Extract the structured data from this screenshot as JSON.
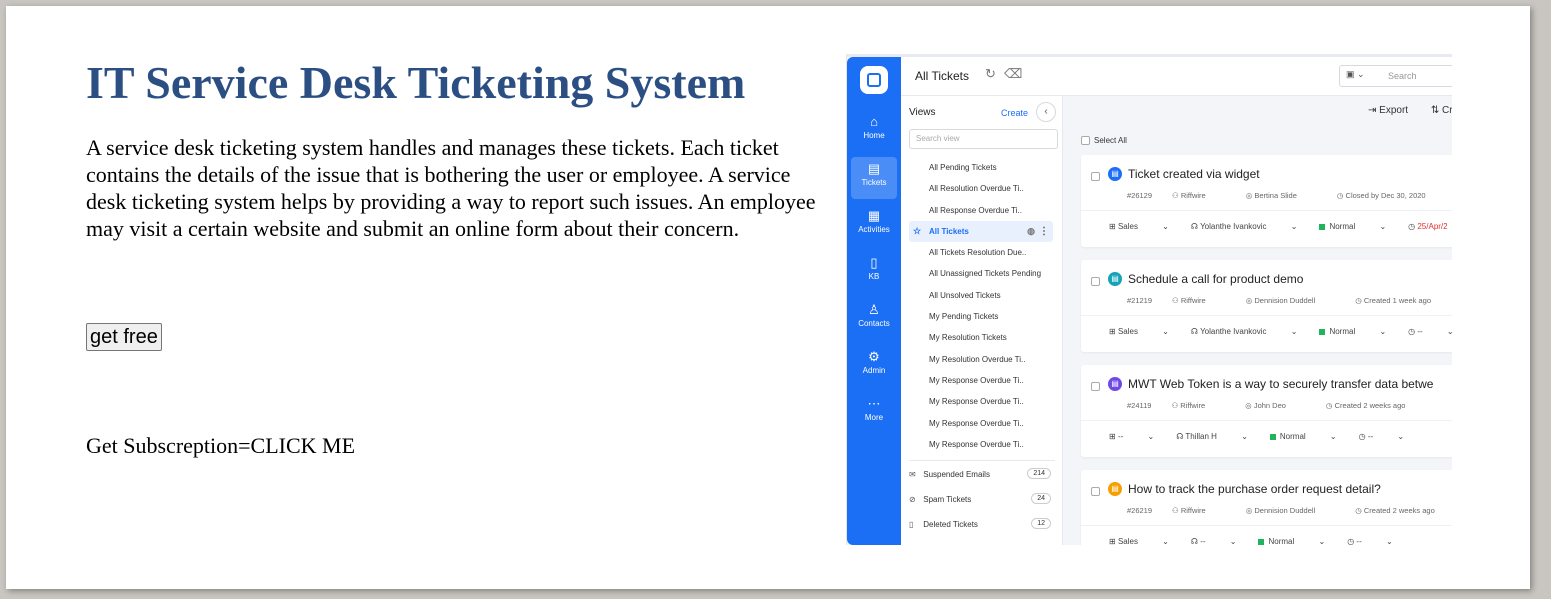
{
  "page": {
    "title": "IT Service Desk Ticketing System",
    "description": "A service desk ticketing system handles and manages these tickets. Each ticket contains the details of the issue that is bothering the user or employee. A service desk ticketing system helps by providing a way to report such issues. An employee may visit a certain website and submit an online form about their concern.",
    "get_free_label": "get free",
    "subscription_text": "Get Subscreption=CLICK ME"
  },
  "app": {
    "nav": [
      {
        "label": "Home",
        "icon": "home-icon"
      },
      {
        "label": "Tickets",
        "icon": "ticket-icon"
      },
      {
        "label": "Activities",
        "icon": "calendar-icon"
      },
      {
        "label": "KB",
        "icon": "book-icon"
      },
      {
        "label": "Contacts",
        "icon": "user-icon"
      },
      {
        "label": "Admin",
        "icon": "gear-icon"
      },
      {
        "label": "More",
        "icon": "ellipsis-icon"
      }
    ],
    "header": {
      "title": "All Tickets",
      "search_placeholder": "Search"
    },
    "views": {
      "title": "Views",
      "create_label": "Create",
      "search_placeholder": "Search view",
      "items": [
        "All Pending Tickets",
        "All Resolution Overdue Ti..",
        "All Response Overdue Ti..",
        "All Tickets",
        "All Tickets Resolution Due..",
        "All Unassigned Tickets Pending",
        "All Unsolved Tickets",
        "My Pending Tickets",
        "My Resolution Tickets",
        "My Resolution Overdue Ti..",
        "My Response Overdue Ti..",
        "My Response Overdue Ti..",
        "My Response Overdue Ti..",
        "My Response Overdue Ti.."
      ],
      "selected_index": 3,
      "extras": [
        {
          "label": "Suspended Emails",
          "count": "214",
          "icon": "mail-icon"
        },
        {
          "label": "Spam Tickets",
          "count": "24",
          "icon": "block-icon"
        },
        {
          "label": "Deleted Tickets",
          "count": "12",
          "icon": "trash-icon"
        }
      ]
    },
    "toolbar": {
      "export_label": "Export",
      "create_label": "Cr",
      "select_all_label": "Select All"
    },
    "tickets": [
      {
        "title": "Ticket created via widget",
        "id": "#26129",
        "company": "Riffwire",
        "contact": "Bertina Slide",
        "status_time": "Closed by Dec 30, 2020",
        "group": "Sales",
        "agent": "Yolanthe Ivankovic",
        "priority": "Normal",
        "due": "25/Apr/2",
        "due_color": "#e03131",
        "icon_color": "#1b6ff5"
      },
      {
        "title": "Schedule a call for product demo",
        "id": "#21219",
        "company": "Riffwire",
        "contact": "Dennision Duddell",
        "status_time": "Created 1 week ago",
        "group": "Sales",
        "agent": "Yolanthe Ivankovic",
        "priority": "Normal",
        "due": "--",
        "due_color": "#444444",
        "icon_color": "#14a3b8"
      },
      {
        "title": "MWT  Web Token is a way to securely transfer data betwe",
        "id": "#24119",
        "company": "Riffwire",
        "contact": "John Deo",
        "status_time": "Created 2 weeks ago",
        "group": "--",
        "agent": "Thillan H",
        "priority": "Normal",
        "due": "--",
        "due_color": "#444444",
        "icon_color": "#7048e8"
      },
      {
        "title": "How to track the purchase order request detail?",
        "id": "#26219",
        "company": "Riffwire",
        "contact": "Dennision Duddell",
        "status_time": "Created 2 weeks ago",
        "group": "Sales",
        "agent": "--",
        "priority": "Normal",
        "due": "--",
        "due_color": "#444444",
        "icon_color": "#f59f00"
      }
    ]
  }
}
